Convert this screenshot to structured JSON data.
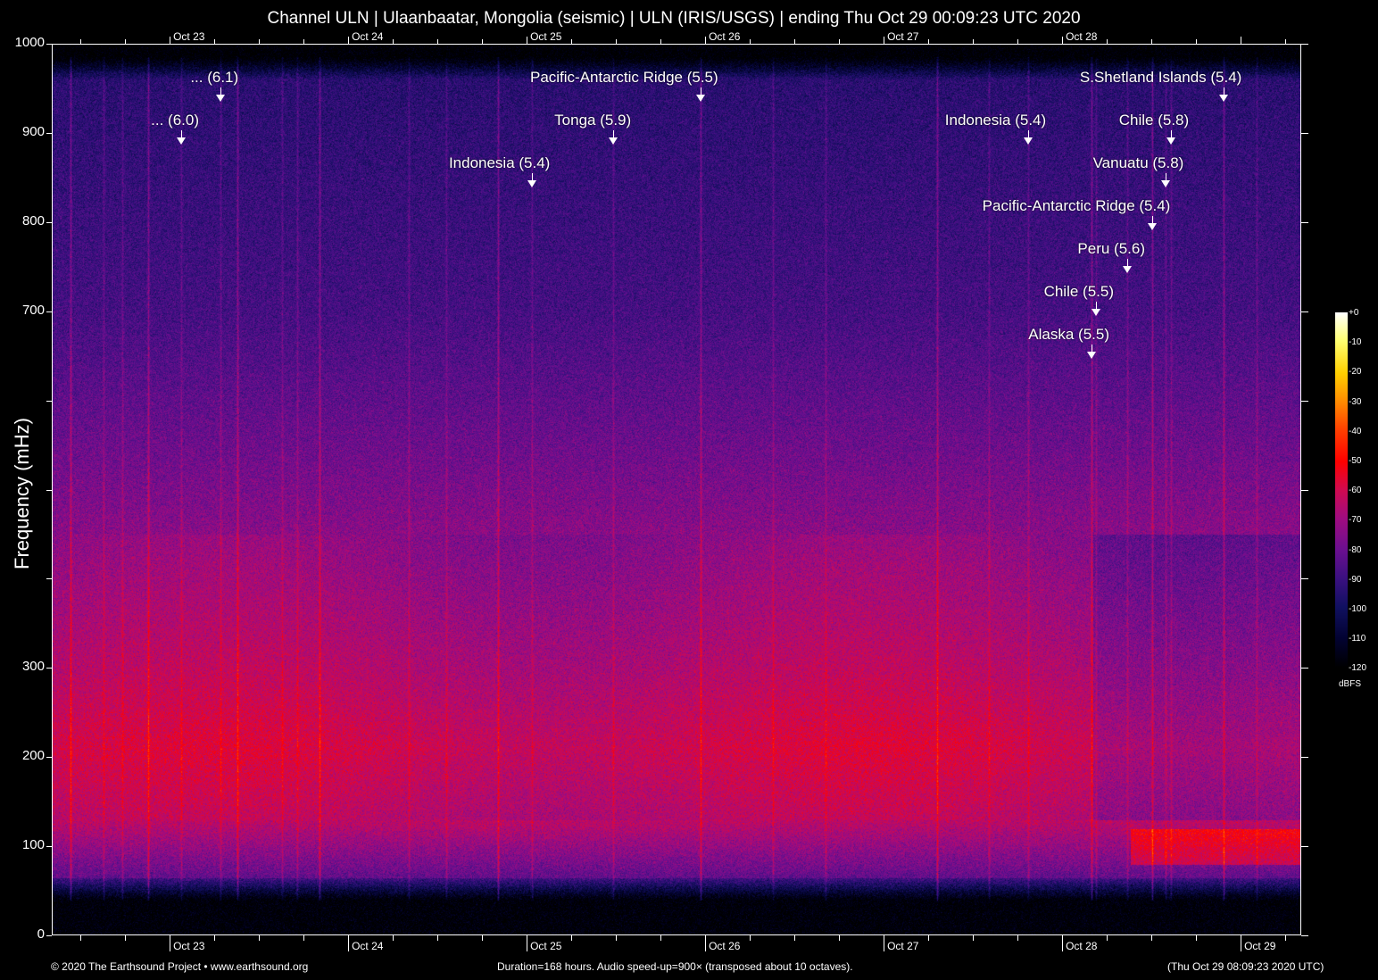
{
  "chart_data": {
    "type": "heatmap",
    "title": "Channel ULN | Ulaanbaatar, Mongolia (seismic) | ULN (IRIS/USGS) | ending Thu Oct 29 00:09:23 UTC 2020",
    "ylabel": "Frequency (mHz)",
    "ylim": [
      0,
      1000
    ],
    "yticks": [
      0,
      100,
      200,
      300,
      400,
      500,
      600,
      700,
      800,
      900,
      1000
    ],
    "ytick_labels": [
      "0",
      "100",
      "200",
      "300",
      "",
      "",
      "",
      "700",
      "800",
      "900",
      "1000"
    ],
    "x_unit": "hours",
    "xlim": [
      0,
      168
    ],
    "xticks_top": [
      {
        "hour": 15.85,
        "label": "Oct 23"
      },
      {
        "hour": 39.85,
        "label": "Oct 24"
      },
      {
        "hour": 63.85,
        "label": "Oct 25"
      },
      {
        "hour": 87.85,
        "label": "Oct 26"
      },
      {
        "hour": 111.85,
        "label": "Oct 27"
      },
      {
        "hour": 135.85,
        "label": "Oct 28"
      }
    ],
    "xticks_bottom": [
      {
        "hour": 15.85,
        "label": "Oct 23"
      },
      {
        "hour": 39.85,
        "label": "Oct 24"
      },
      {
        "hour": 63.85,
        "label": "Oct 25"
      },
      {
        "hour": 87.85,
        "label": "Oct 26"
      },
      {
        "hour": 111.85,
        "label": "Oct 27"
      },
      {
        "hour": 135.85,
        "label": "Oct 28"
      },
      {
        "hour": 159.85,
        "label": "Oct 29"
      }
    ],
    "colorbar": {
      "unit": "dBFS",
      "range": [
        -120,
        0
      ],
      "ticks": [
        "+0",
        "-10",
        "-20",
        "-30",
        "-40",
        "-50",
        "-60",
        "-70",
        "-80",
        "-90",
        "-100",
        "-110",
        "-120"
      ]
    },
    "events": [
      {
        "label": "... (6.1)",
        "hour": 22.7
      },
      {
        "label": "... (6.0)",
        "hour": 17.4
      },
      {
        "label": "Pacific-Antarctic Ridge (5.5)",
        "hour": 87.2
      },
      {
        "label": "Tonga (5.9)",
        "hour": 75.5
      },
      {
        "label": "Indonesia (5.4)",
        "hour": 64.6
      },
      {
        "label": "Indonesia (5.4)",
        "hour": 131.3
      },
      {
        "label": "S.Shetland Islands (5.4)",
        "hour": 157.6
      },
      {
        "label": "Chile (5.8)",
        "hour": 150.5
      },
      {
        "label": "Vanuatu (5.8)",
        "hour": 149.8
      },
      {
        "label": "Pacific-Antarctic Ridge (5.4)",
        "hour": 148.0
      },
      {
        "label": "Peru (5.6)",
        "hour": 144.6
      },
      {
        "label": "Chile (5.5)",
        "hour": 140.4
      },
      {
        "label": "Alaska (5.5)",
        "hour": 139.8
      }
    ],
    "peak_band_mHz": [
      150,
      300
    ],
    "peak_level_dBFS": -55
  },
  "footer": {
    "copyright": "© 2020 The Earthsound Project • www.earthsound.org",
    "info": "Duration=168 hours. Audio speed-up=900× (transposed about 10 octaves).",
    "timestamp": "(Thu Oct 29 08:09:23 2020 UTC)"
  }
}
